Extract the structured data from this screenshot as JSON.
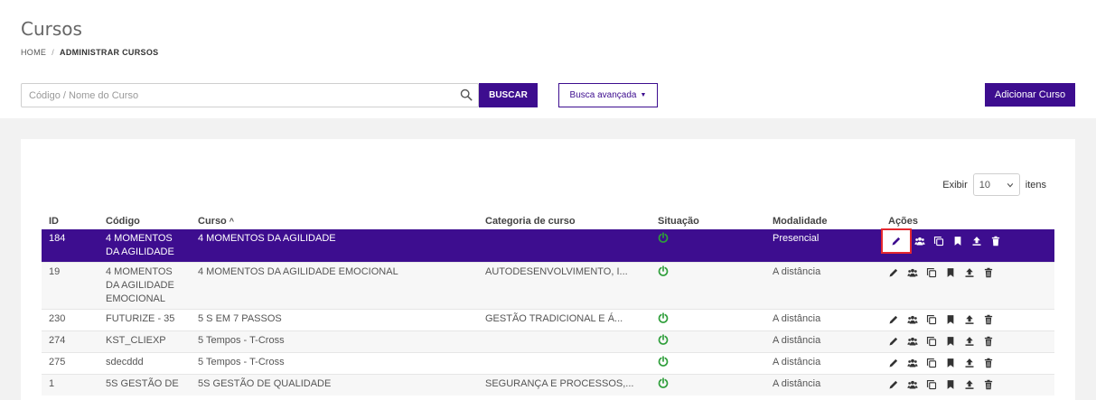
{
  "page": {
    "title": "Cursos"
  },
  "breadcrumb": {
    "home": "HOME",
    "sep": "/",
    "current": "ADMINISTRAR CURSOS"
  },
  "search": {
    "placeholder": "Código / Nome do Curso",
    "value": ""
  },
  "buttons": {
    "buscar": "BUSCAR",
    "busca_avancada": "Busca avançada",
    "adicionar": "Adicionar Curso"
  },
  "pagination": {
    "exibir_label": "Exibir",
    "per_page": "10",
    "itens_label": "itens"
  },
  "table": {
    "columns": {
      "id": "ID",
      "codigo": "Código",
      "curso": "Curso",
      "categoria": "Categoria de curso",
      "situacao": "Situação",
      "modalidade": "Modalidade",
      "acoes": "Ações"
    },
    "rows": [
      {
        "id": "184",
        "codigo": "4 MOMENTOS DA AGILIDADE",
        "curso": "4 MOMENTOS DA AGILIDADE",
        "categoria": "",
        "modalidade": "Presencial"
      },
      {
        "id": "19",
        "codigo": "4 MOMENTOS DA AGILIDADE EMOCIONAL",
        "curso": "4 MOMENTOS DA AGILIDADE EMOCIONAL",
        "categoria": "AUTODESENVOLVIMENTO, I...",
        "modalidade": "A distância"
      },
      {
        "id": "230",
        "codigo": "FUTURIZE - 35",
        "curso": "5 S EM 7 PASSOS",
        "categoria": "GESTÃO TRADICIONAL E Á...",
        "modalidade": "A distância"
      },
      {
        "id": "274",
        "codigo": "KST_CLIEXP",
        "curso": "5 Tempos - T-Cross",
        "categoria": "",
        "modalidade": "A distância"
      },
      {
        "id": "275",
        "codigo": "sdecddd",
        "curso": "5 Tempos - T-Cross",
        "categoria": "",
        "modalidade": "A distância"
      },
      {
        "id": "1",
        "codigo": "5S GESTÃO DE",
        "curso": "5S GESTÃO DE QUALIDADE",
        "categoria": "SEGURANÇA E PROCESSOS,...",
        "modalidade": "A distância"
      }
    ]
  },
  "colors": {
    "primary": "#3d0d8f",
    "active_green": "#2e9e3a",
    "highlight_red": "#e5282f"
  },
  "icons": [
    "search-icon",
    "chevron-down-icon",
    "power-icon",
    "pencil-icon",
    "users-icon",
    "copy-icon",
    "bookmark-icon",
    "upload-icon",
    "trash-icon"
  ]
}
